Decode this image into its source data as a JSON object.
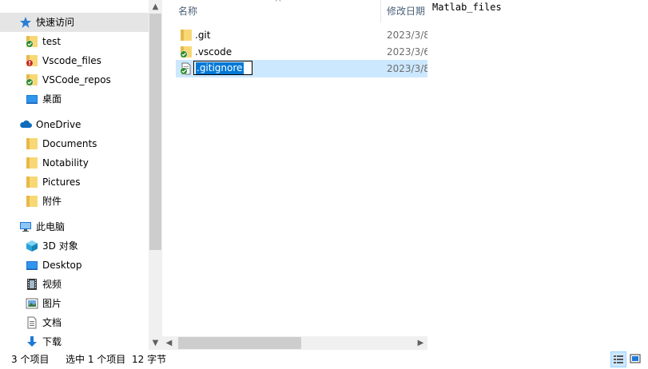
{
  "nav": {
    "quick_access": "快速访问",
    "items": [
      {
        "label": "快速访问",
        "icon": "star-icon"
      },
      {
        "label": "test",
        "icon": "folder-synced-icon"
      },
      {
        "label": "Vscode_files",
        "icon": "folder-error-icon"
      },
      {
        "label": "VSCode_repos",
        "icon": "folder-synced-icon"
      },
      {
        "label": "桌面",
        "icon": "desktop-icon"
      },
      {
        "label": "OneDrive",
        "icon": "cloud-icon"
      },
      {
        "label": "Documents",
        "icon": "folder-icon"
      },
      {
        "label": "Notability",
        "icon": "folder-icon"
      },
      {
        "label": "Pictures",
        "icon": "folder-icon"
      },
      {
        "label": "附件",
        "icon": "folder-icon"
      },
      {
        "label": "此电脑",
        "icon": "computer-icon"
      },
      {
        "label": "3D 对象",
        "icon": "cube-icon"
      },
      {
        "label": "Desktop",
        "icon": "desktop-icon"
      },
      {
        "label": "视频",
        "icon": "video-icon"
      },
      {
        "label": "图片",
        "icon": "picture-icon"
      },
      {
        "label": "文档",
        "icon": "document-icon"
      },
      {
        "label": "下载",
        "icon": "download-icon"
      }
    ]
  },
  "columns": {
    "name": "名称",
    "date": "修改日期"
  },
  "files": [
    {
      "name": ".git",
      "date": "2023/3/8",
      "icon": "folder-icon"
    },
    {
      "name": ".vscode",
      "date": "2023/3/6",
      "icon": "folder-synced-icon"
    },
    {
      "name": ".gitignore",
      "date": "2023/3/8",
      "icon": "file-synced-icon"
    }
  ],
  "rename_value": ".gitignore",
  "preview_text": "Matlab_files",
  "status": {
    "count": "3 个项目",
    "selected": "选中 1 个项目",
    "size": "12 字节"
  }
}
